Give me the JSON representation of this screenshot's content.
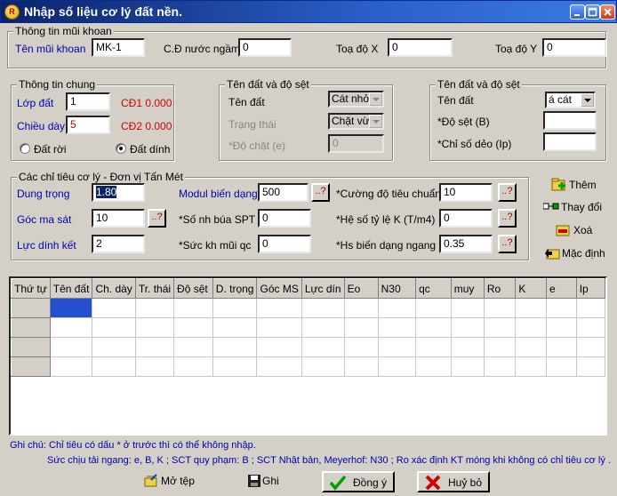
{
  "window": {
    "title": "Nhập số liệu cơ lý đất nền.",
    "icon_text": "R"
  },
  "borehole": {
    "legend": "Thông tin mũi khoan",
    "name_label": "Tên mũi khoan",
    "name_value": "MK-1",
    "gw_label": "C.Đ nước ngầm",
    "gw_value": "0",
    "x_label": "Toạ độ X",
    "x_value": "0",
    "y_label": "Toạ độ Y",
    "y_value": "0"
  },
  "general": {
    "legend": "Thông tin chung",
    "layer_label": "Lớp đất",
    "layer_value": "1",
    "cd1": "CĐ1 0.000",
    "thick_label": "Chiều dày",
    "thick_value": "5",
    "cd2": "CĐ2 0.000",
    "radio_loose": "Đất rời",
    "radio_cohesive": "Đất dính"
  },
  "soil_mid": {
    "legend": "Tên đất và độ sệt",
    "name_label": "Tên đất",
    "name_value": "Cát nhỏ",
    "state_label": "Trạng thái",
    "state_value": "Chặt vừ",
    "density_label": "*Độ chặt (e)",
    "density_value": "0"
  },
  "soil_right": {
    "legend": "Tên đất và độ sệt",
    "name_label": "Tên đất",
    "name_value": "á cát",
    "consistency_label": "*Độ sệt (B)",
    "consistency_value": "",
    "plasticity_label": "*Chỉ số dẻo (Ip)",
    "plasticity_value": ""
  },
  "mech": {
    "legend": "Các chỉ tiêu cơ lý - Đơn vị Tấn Mét",
    "unit_weight_label": "Dung trọng",
    "unit_weight_value": "1.80",
    "friction_label": "Góc ma sát",
    "friction_value": "10",
    "cohesion_label": "Lực dính kết",
    "cohesion_value": "2",
    "modulus_label": "Modul biến dạng",
    "modulus_value": "500",
    "spt_label": "*Số nh búa SPT",
    "spt_value": "0",
    "qc_label": "*Sức kh mũi qc",
    "qc_value": "0",
    "std_strength_label": "*Cường độ tiêu chuẩn",
    "std_strength_value": "10",
    "k_label": "*Hệ số tỷ lệ K (T/m4)",
    "k_value": "0",
    "horiz_label": "*Hs biến dạng ngang",
    "horiz_value": "0.35",
    "q_btn": "..?"
  },
  "actions": {
    "add": "Thêm",
    "edit": "Thay đổi",
    "delete": "Xoá",
    "default": "Mặc định"
  },
  "grid": {
    "columns": [
      "Thứ tự",
      "Tên đất",
      "Ch. dày",
      "Tr. thái",
      "Độ sệt",
      "D. trọng",
      "Góc MS",
      "Lực dín",
      "Eo",
      "N30",
      "qc",
      "muy",
      "Ro",
      "K",
      "e",
      "Ip"
    ]
  },
  "notes": {
    "line1": "Ghi chú: Chỉ tiêu có dấu * ở trước thì có thể không nhập.",
    "line2": "Sức chịu tải ngang: e, B, K ; SCT quy phạm: B ; SCT Nhật bản, Meyerhof: N30 ; Ro xác định KT móng khi không có chỉ tiêu cơ lý ."
  },
  "footer": {
    "open": "Mở tệp",
    "save": "Ghi",
    "ok": "Đồng ý",
    "cancel": "Huỷ bỏ"
  },
  "colors": {
    "title_bar": "#0a246a",
    "label_blue": "#0000b0",
    "label_red": "#d00000",
    "selected_cell": "#2250d0"
  }
}
